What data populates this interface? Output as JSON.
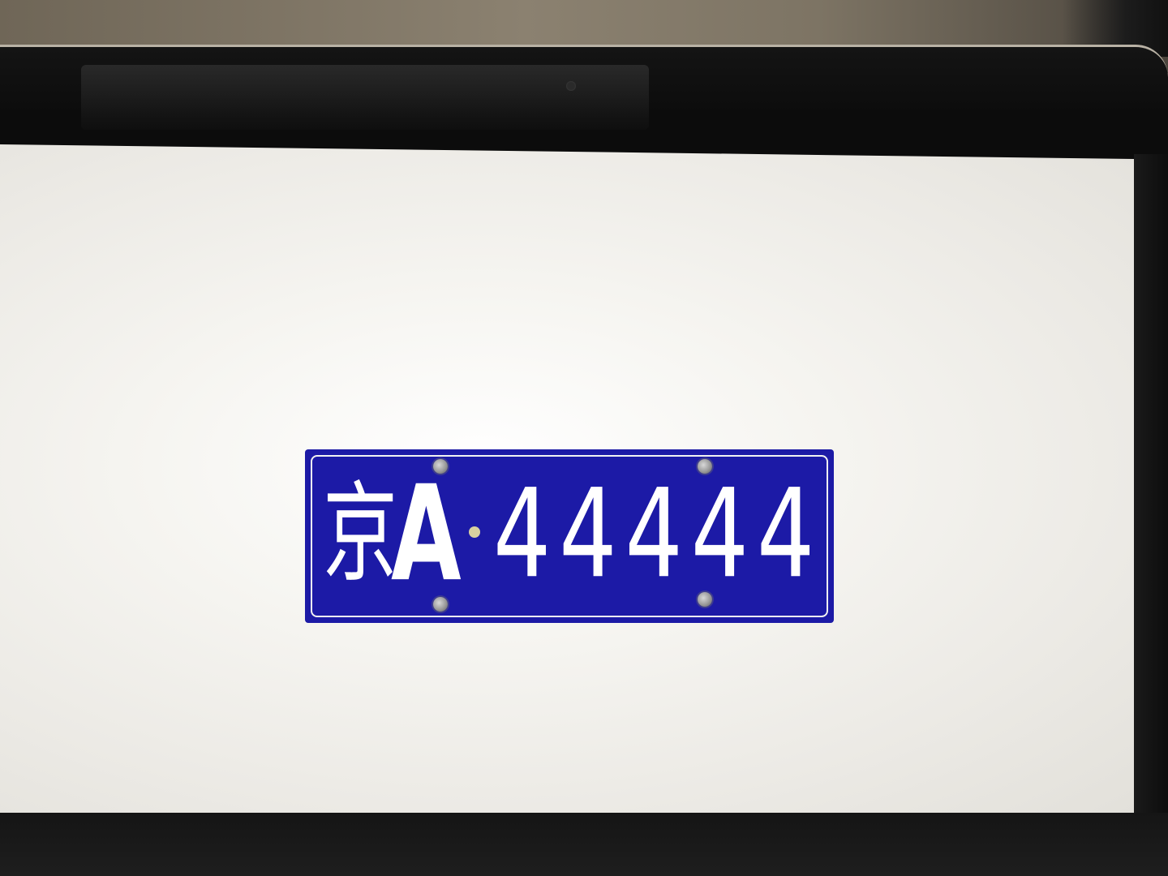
{
  "plate": {
    "province": "京",
    "letter": "A",
    "number": "44444",
    "background_color": "#1c1aa6",
    "text_color": "#ffffff"
  }
}
